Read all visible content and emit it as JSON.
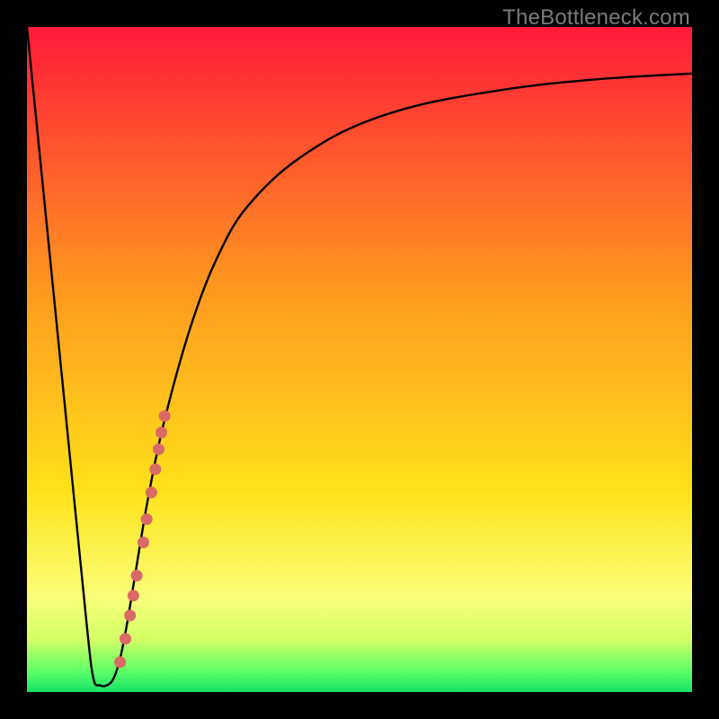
{
  "watermark": "TheBottleneck.com",
  "colors": {
    "frame": "#000000",
    "curve": "#000000",
    "dot": "#d96a66",
    "gradient_top": "#ff1a3a",
    "gradient_mid1": "#ff7a1f",
    "gradient_mid2": "#ffe21a",
    "gradient_band": "#f8ff7a",
    "gradient_bottom": "#17e06a"
  },
  "chart_data": {
    "type": "line",
    "title": "",
    "xlabel": "",
    "ylabel": "",
    "xlim": [
      0,
      100
    ],
    "ylim": [
      0,
      100
    ],
    "curve": {
      "x": [
        0,
        3,
        6,
        9,
        10,
        11,
        12,
        13,
        14,
        15,
        16,
        18,
        20,
        22,
        24,
        26,
        28,
        31,
        34,
        38,
        42,
        47,
        53,
        60,
        68,
        77,
        88,
        100
      ],
      "y": [
        100,
        70,
        40,
        10,
        2,
        1,
        1,
        2,
        5,
        10,
        16,
        28,
        38,
        46,
        53,
        59,
        64,
        70,
        74,
        78,
        81,
        84,
        86.5,
        88.5,
        90,
        91.3,
        92.3,
        93
      ]
    },
    "series": [
      {
        "name": "dots",
        "type": "scatter",
        "points": [
          {
            "x": 14.0,
            "y": 4.5
          },
          {
            "x": 14.8,
            "y": 8.0
          },
          {
            "x": 15.5,
            "y": 11.5
          },
          {
            "x": 16.0,
            "y": 14.5
          },
          {
            "x": 16.5,
            "y": 17.5
          },
          {
            "x": 17.5,
            "y": 22.5
          },
          {
            "x": 18.0,
            "y": 26.0
          },
          {
            "x": 18.7,
            "y": 30.0
          },
          {
            "x": 19.3,
            "y": 33.5
          },
          {
            "x": 19.8,
            "y": 36.5
          },
          {
            "x": 20.2,
            "y": 39.0
          },
          {
            "x": 20.7,
            "y": 41.5
          }
        ]
      }
    ],
    "gradient_stops": [
      {
        "pct": 0,
        "color": "#ff1a3a"
      },
      {
        "pct": 40,
        "color": "#ff9a1f"
      },
      {
        "pct": 70,
        "color": "#ffe21a"
      },
      {
        "pct": 86,
        "color": "#f8ff7a"
      },
      {
        "pct": 92,
        "color": "#d4ff66"
      },
      {
        "pct": 97,
        "color": "#5cff66"
      },
      {
        "pct": 100,
        "color": "#17e06a"
      }
    ]
  }
}
